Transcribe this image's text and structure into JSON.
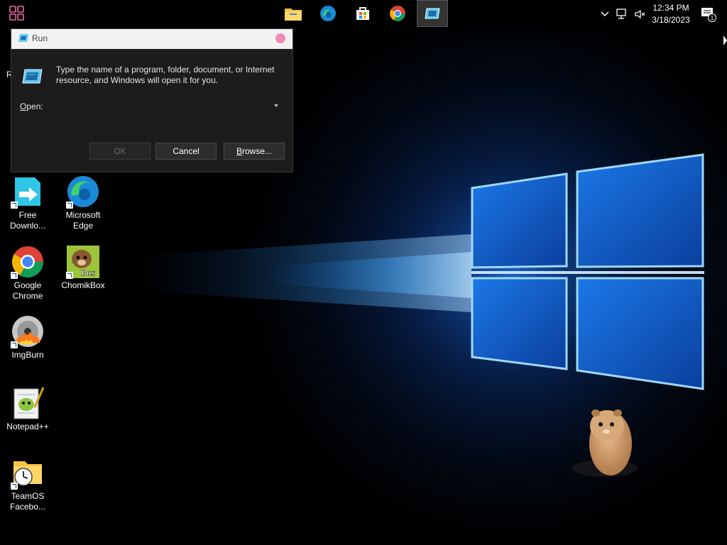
{
  "taskbar": {
    "apps": [
      {
        "name": "file-explorer"
      },
      {
        "name": "edge"
      },
      {
        "name": "microsoft-store"
      },
      {
        "name": "chrome"
      },
      {
        "name": "run",
        "active": true
      }
    ],
    "clock": {
      "time": "12:34 PM",
      "date": "3/18/2023"
    },
    "notifications": {
      "count": "1"
    }
  },
  "desktop": {
    "partial_label": "R",
    "icons": [
      {
        "label": "Free Downlo...",
        "icon": "free-download-manager-icon"
      },
      {
        "label": "Microsoft Edge",
        "icon": "edge-icon"
      },
      {
        "label": "Google Chrome",
        "icon": "chrome-icon"
      },
      {
        "label": "ChomikBox",
        "icon": "chomikbox-icon",
        "badge": "Box"
      },
      {
        "label": "ImgBurn",
        "icon": "imgburn-icon"
      },
      {
        "label": "Notepad++",
        "icon": "notepad-plus-plus-icon"
      },
      {
        "label": "TeamOS Facebo...",
        "icon": "folder-clock-icon"
      }
    ]
  },
  "run_dialog": {
    "title": "Run",
    "message": "Type the name of a program, folder, document, or Internet resource, and Windows will open it for you.",
    "open_label_underline": "O",
    "open_label_rest": "pen:",
    "open_value": "",
    "ok_label": "OK",
    "cancel_label": "Cancel",
    "browse_underline": "B",
    "browse_rest": "rowse..."
  },
  "colors": {
    "dialog_bg": "#1c1c1c",
    "title_bar": "#f2f2f2",
    "close_button": "#ee8cb4",
    "wallpaper_glow": "#1e90ff"
  }
}
